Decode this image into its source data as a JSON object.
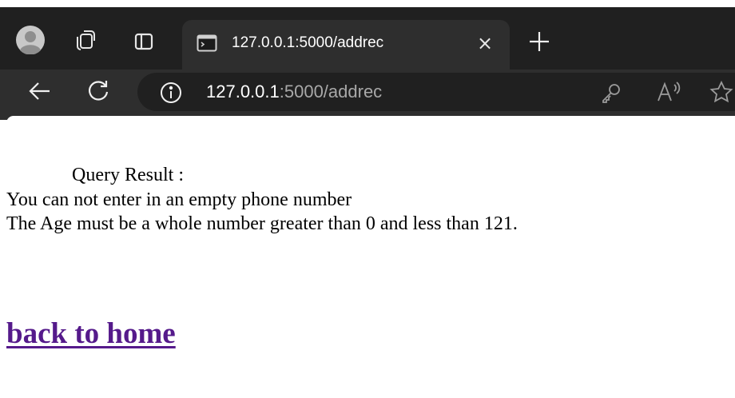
{
  "tab": {
    "title": "127.0.0.1:5000/addrec",
    "close_glyph": "×"
  },
  "address_bar": {
    "host": "127.0.0.1",
    "path": ":5000/addrec"
  },
  "icons": {
    "profile": "profile-avatar-icon",
    "workspaces": "workspaces-icon",
    "tab_actions": "tab-actions-icon",
    "favicon": "terminal-favicon-icon",
    "new_tab": "plus-icon",
    "back": "back-arrow-icon",
    "refresh": "refresh-icon",
    "site_info": "info-icon",
    "password": "key-icon",
    "read_aloud": "read-aloud-icon",
    "favorite": "star-icon"
  },
  "page": {
    "query_label": "Query Result :",
    "messages": [
      "You can not enter in an empty phone number",
      "The Age must be a whole number greater than 0 and less than 121."
    ],
    "home_link": "back to home"
  },
  "colors": {
    "chrome_dark": "#202020",
    "chrome_tab": "#2e2e2e",
    "visited_link": "#551a8b",
    "page_background": "#ffffff"
  }
}
